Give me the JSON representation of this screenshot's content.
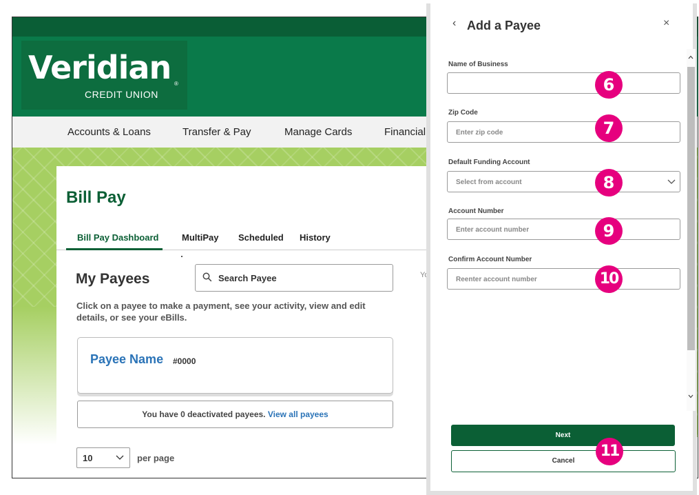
{
  "brand": {
    "name": "Veridian",
    "sub": "CREDIT UNION",
    "reg": "®"
  },
  "nav": [
    "Accounts & Loans",
    "Transfer & Pay",
    "Manage Cards",
    "Financial W"
  ],
  "page": {
    "title": "Bill Pay",
    "tabs": [
      "Bill Pay Dashboard",
      "MultiPay",
      "Scheduled",
      "History"
    ]
  },
  "payees": {
    "title": "My Payees",
    "search_placeholder": "Search Payee",
    "help": "Click on a payee to make a payment, see your activity, view and edit details, or see your eBills.",
    "payee_name": "Payee Name",
    "payee_number": "#0000",
    "deactivated_text": "You have 0 deactivated payees.",
    "deactivated_link": "View all payees",
    "per_page_value": "10",
    "per_page_label": "per page",
    "truncated_text": "Yo"
  },
  "panel": {
    "back_icon": "‹",
    "title": "Add a Payee",
    "close_icon": "×",
    "fields": [
      {
        "label": "Name of Business",
        "placeholder": "",
        "badge": "6"
      },
      {
        "label": "Zip Code",
        "placeholder": "Enter zip code",
        "badge": "7"
      },
      {
        "label": "Default Funding Account",
        "placeholder": "Select from account",
        "badge": "8"
      },
      {
        "label": "Account Number",
        "placeholder": "Enter account number",
        "badge": "9"
      },
      {
        "label": "Confirm Account Number",
        "placeholder": "Reenter account number",
        "badge": "10"
      }
    ],
    "next_label": "Next",
    "cancel_label": "Cancel",
    "buttons_badge": "11"
  },
  "colors": {
    "brand_green": "#0a7a4a",
    "dark_green": "#0b5f35",
    "pattern_green": "#a6cf62",
    "link_blue": "#2a73b7",
    "badge_magenta": "#e6007e"
  }
}
